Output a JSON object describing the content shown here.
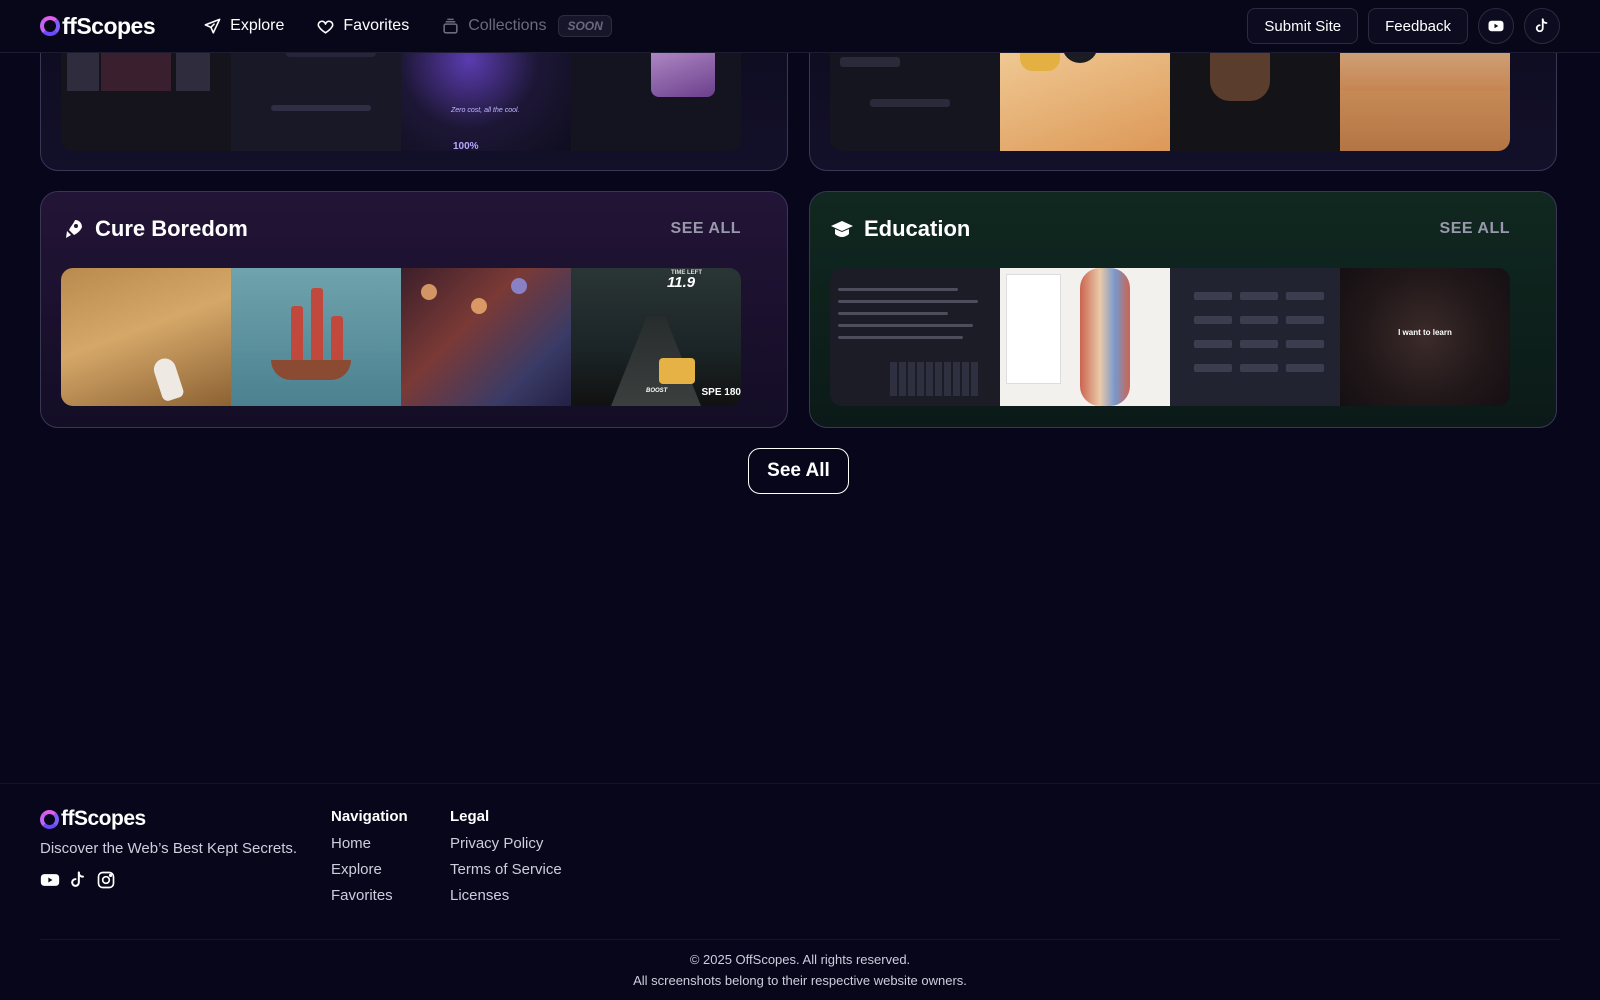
{
  "nav": {
    "logo_rest": "ffScopes",
    "links": [
      {
        "label": "Explore",
        "icon": "paper-plane-icon"
      },
      {
        "label": "Favorites",
        "icon": "heart-icon"
      },
      {
        "label": "Collections",
        "icon": "collections-icon",
        "badge": "SOON",
        "disabled": true
      }
    ],
    "submit_label": "Submit Site",
    "feedback_label": "Feedback",
    "social": [
      "youtube-icon",
      "tiktok-icon"
    ]
  },
  "categories": [
    {
      "title": "Cure Boredom",
      "icon": "rocket-icon",
      "see_all": "SEE ALL",
      "theme": "purple"
    },
    {
      "title": "Education",
      "icon": "graduation-cap-icon",
      "see_all": "SEE ALL",
      "theme": "green"
    }
  ],
  "thumb_text": {
    "race_time": "11.9",
    "race_time_label": "TIME LEFT",
    "race_boost": "BOOST",
    "race_speed": "SPE 180",
    "learn": "I want to learn",
    "zero_cost": "Zero cost, all the cool.",
    "percent": "100%"
  },
  "see_all_button": "See All",
  "footer": {
    "logo_rest": "ffScopes",
    "tagline": "Discover the Web’s Best Kept Secrets.",
    "social": [
      "youtube-icon",
      "tiktok-icon",
      "instagram-icon"
    ],
    "navigation": {
      "heading": "Navigation",
      "links": [
        "Home",
        "Explore",
        "Favorites"
      ]
    },
    "legal": {
      "heading": "Legal",
      "links": [
        "Privacy Policy",
        "Terms of Service",
        "Licenses"
      ]
    },
    "copyright": "© 2025 OffScopes. All rights reserved.",
    "disclaimer": "All screenshots belong to their respective website owners."
  },
  "colors": {
    "background": "#07061a",
    "accent": "#a75cf5",
    "card_purple": "#221436",
    "card_green": "#102820"
  }
}
